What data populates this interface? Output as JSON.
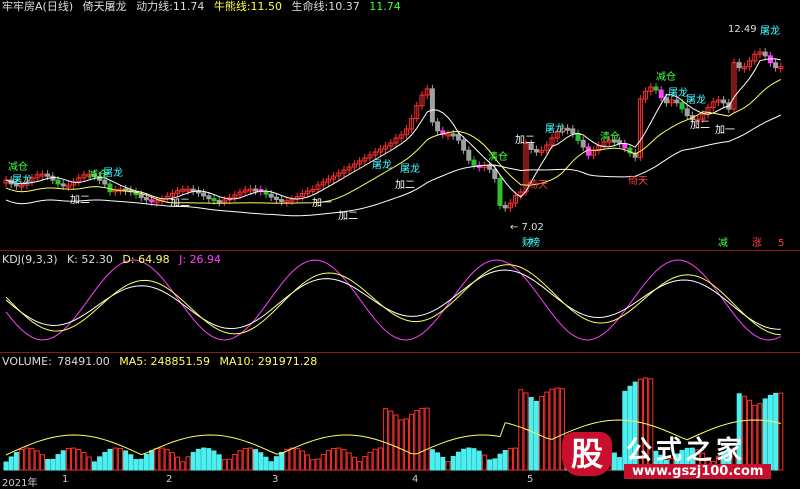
{
  "header": {
    "title": "牢牢房A(日线)",
    "indicator": "倚天屠龙",
    "dongli_label": "动力线:",
    "dongli_val": "11.74",
    "niuxiong_label": "牛熊线:",
    "niuxiong_val": "11.50",
    "shengming_label": "生命线:",
    "shengming_val": "10.37",
    "extra_val": "11.74"
  },
  "main": {
    "high_label": "12.49",
    "low_label": "7.02",
    "signals": [
      "减仓",
      "屠龙",
      "加二",
      "减仓",
      "屠龙",
      "加二",
      "加一",
      "加二",
      "屠龙",
      "加二",
      "屠龙",
      "清仓",
      "倚天",
      "加二",
      "屠龙",
      "清仓",
      "倚天",
      "减仓",
      "屠龙",
      "加二",
      "屠龙",
      "加一",
      "屠龙"
    ],
    "events": [
      "财",
      "榜",
      "减",
      "涨",
      "5"
    ]
  },
  "kdj": {
    "name": "KDJ(9,3,3)",
    "k_label": "K:",
    "k": "52.30",
    "d_label": "D:",
    "d": "64.98",
    "j_label": "J:",
    "j": "26.94"
  },
  "volume": {
    "name": "VOLUME:",
    "vol": "78491.00",
    "ma5_label": "MA5:",
    "ma5": "248851.59",
    "ma10_label": "MA10:",
    "ma10": "291971.28"
  },
  "xaxis": [
    "2021年",
    "1",
    "2",
    "3",
    "4",
    "5"
  ],
  "watermark": {
    "char": "股",
    "text": "公式之家",
    "url": "www.gszj100.com"
  },
  "colors": {
    "up": "#ff3030",
    "down": "#4df0f0",
    "k": "#ffffff",
    "d": "#ffff60",
    "j": "#ff40ff",
    "bg": "#000000"
  }
}
